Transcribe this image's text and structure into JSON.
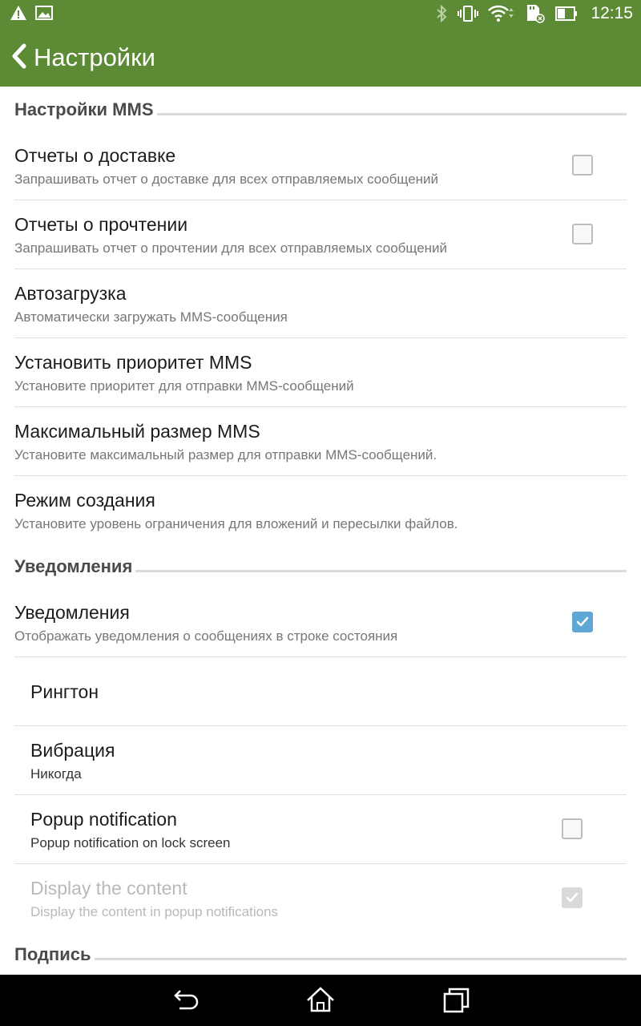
{
  "status_bar": {
    "time": "12:15",
    "left_icons": [
      "warning-icon",
      "image-icon"
    ],
    "right_icons": [
      "bluetooth-icon",
      "vibrate-icon",
      "wifi-icon",
      "sd-card-icon",
      "battery-icon"
    ]
  },
  "action_bar": {
    "back_icon": "chevron-left-icon",
    "title": "Настройки",
    "color": "#5d8a35"
  },
  "sections": {
    "mms": {
      "label": "Настройки MMS"
    },
    "notifications": {
      "label": "Уведомления"
    },
    "signature": {
      "label": "Подпись"
    }
  },
  "prefs": {
    "delivery_reports": {
      "title": "Отчеты о доставке",
      "summary": "Запрашивать отчет о доставке для всех отправляемых сообщений",
      "checked": false
    },
    "read_reports": {
      "title": "Отчеты о прочтении",
      "summary": "Запрашивать отчет о прочтении для всех отправляемых сообщений",
      "checked": false
    },
    "auto_download": {
      "title": "Автозагрузка",
      "summary": "Автоматически загружать MMS-сообщения"
    },
    "mms_priority": {
      "title": "Установить приоритет MMS",
      "summary": "Установите приоритет для отправки MMS-сообщений"
    },
    "mms_max_size": {
      "title": "Максимальный размер MMS",
      "summary": "Установите максимальный размер для отправки MMS-сообщений."
    },
    "creation_mode": {
      "title": "Режим создания",
      "summary": "Установите уровень ограничения для вложений и пересылки файлов."
    },
    "notifications": {
      "title": "Уведомления",
      "summary": "Отображать уведомления о сообщениях в строке состояния",
      "checked": true
    },
    "ringtone": {
      "title": "Рингтон"
    },
    "vibration": {
      "title": "Вибрация",
      "summary": "Никогда"
    },
    "popup_notification": {
      "title": "Popup notification",
      "summary": "Popup notification on lock screen",
      "checked": false
    },
    "display_content": {
      "title": "Display the content",
      "summary": "Display the content in popup notifications",
      "checked": true,
      "enabled": false
    }
  },
  "nav_bar": {
    "icons": [
      "back-icon",
      "home-icon",
      "recents-icon"
    ]
  },
  "colors": {
    "accent": "#5d8a35",
    "checkbox_checked": "#5fa8d6"
  }
}
